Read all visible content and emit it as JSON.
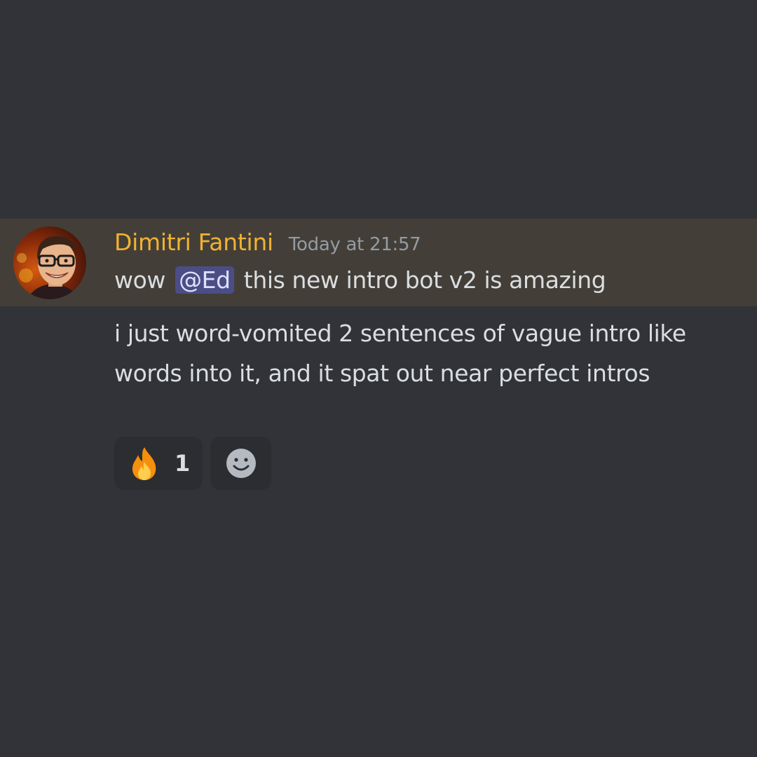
{
  "message": {
    "author": "Dimitri Fantini",
    "timestamp": "Today at 21:57",
    "line1_before": "wow",
    "mention": "@Ed",
    "line1_after": "this new intro bot v2 is amazing",
    "line2": "i just word-vomited 2 sentences of vague intro like words into it, and it spat out near perfect intros"
  },
  "reactions": [
    {
      "emoji": "fire-icon",
      "count": "1"
    }
  ],
  "add_reaction_icon": "smiley-icon",
  "colors": {
    "background": "#313338",
    "highlight": "#433f38",
    "username": "#f0b232",
    "mention_bg": "#5865f2",
    "text": "#dbdee1",
    "muted": "#949ba4"
  }
}
